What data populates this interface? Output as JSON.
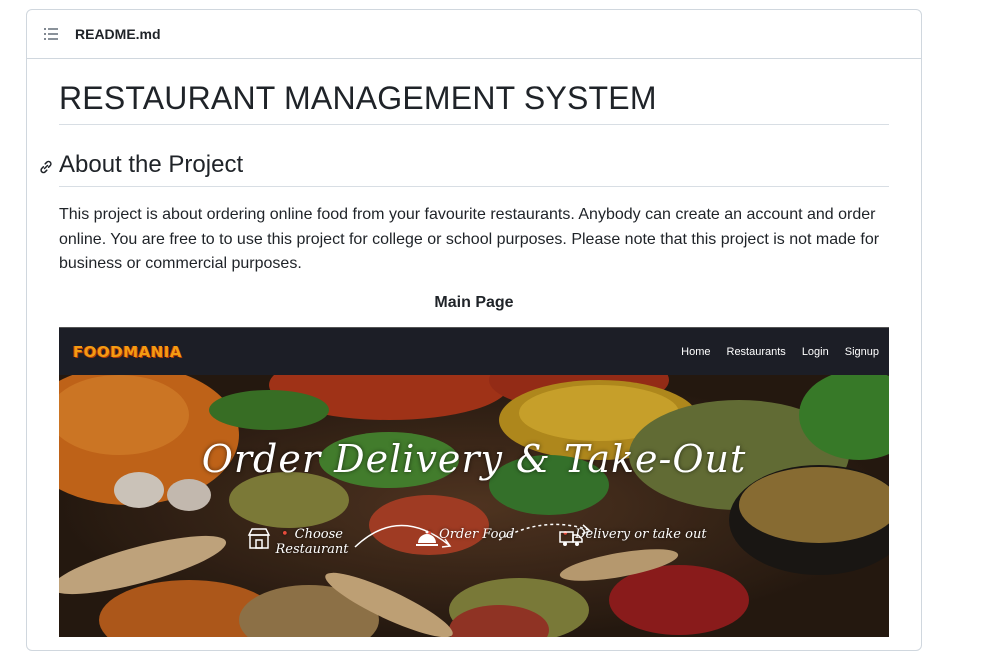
{
  "readme": {
    "file_name": "README.md",
    "title": "RESTAURANT MANAGEMENT SYSTEM",
    "section_heading": "About the Project",
    "description": "This project is about ordering online food from your favourite restaurants. Anybody can create an account and order online. You are free to to use this project for college or school purposes. Please note that this project is not made for business or commercial purposes.",
    "caption": "Main Page"
  },
  "screenshot": {
    "logo": "FOODMANIA",
    "nav_links": [
      "Home",
      "Restaurants",
      "Login",
      "Signup"
    ],
    "hero_title": "Order Delivery & Take-Out",
    "steps": [
      {
        "icon": "store-icon",
        "label": "Choose Restaurant"
      },
      {
        "icon": "cloche-icon",
        "label": "Order Food"
      },
      {
        "icon": "delivery-truck-icon",
        "label": "Delivery or take out"
      }
    ]
  },
  "colors": {
    "border": "#d0d7de",
    "text": "#1f2328",
    "site_nav": "#1c1e26",
    "logo": "#f39c12",
    "step_dot": "#e74c3c"
  }
}
